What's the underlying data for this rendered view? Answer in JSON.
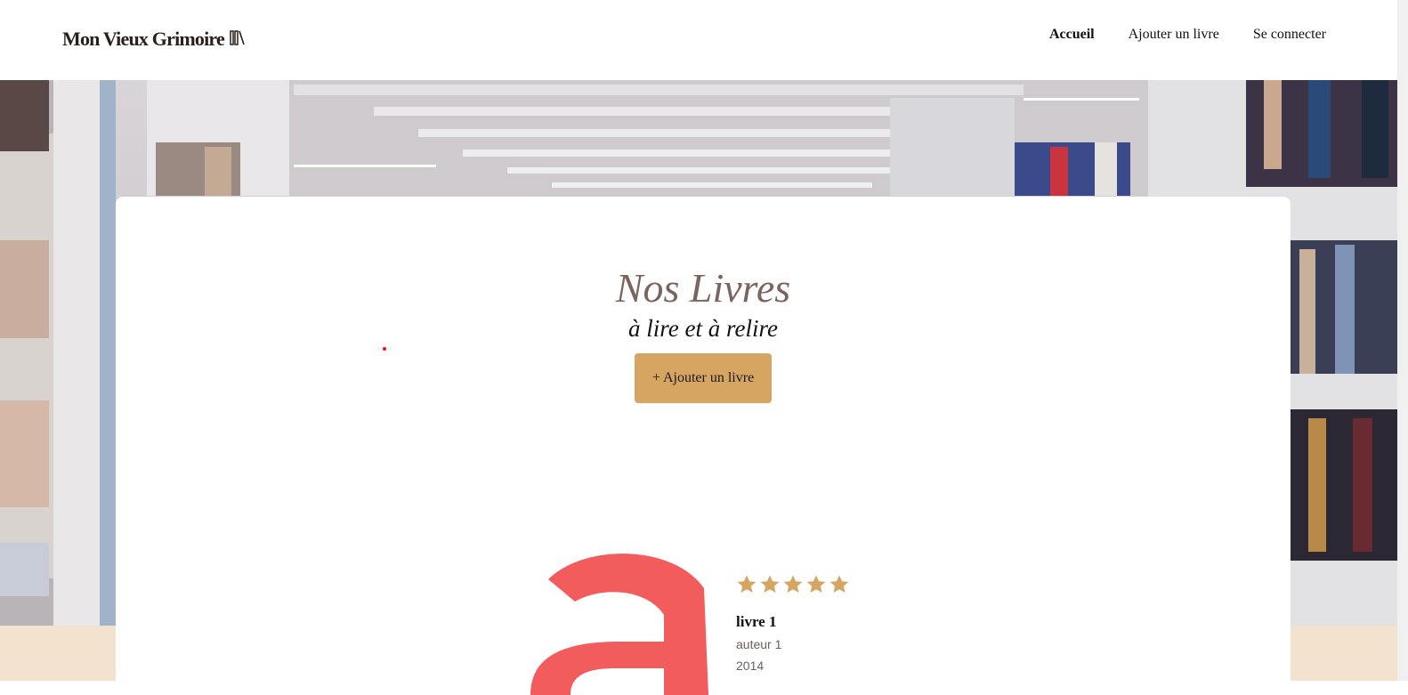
{
  "header": {
    "logo_text": "Mon Vieux Grimoire",
    "nav": [
      {
        "label": "Accueil",
        "active": true
      },
      {
        "label": "Ajouter un livre",
        "active": false
      },
      {
        "label": "Se connecter",
        "active": false
      }
    ]
  },
  "main": {
    "title": "Nos Livres",
    "subtitle": "à lire et à relire",
    "add_button_label": "+ Ajouter un livre",
    "books": [
      {
        "cover_letter": "a",
        "rating": 5,
        "title": "livre 1",
        "author": "auteur 1",
        "year": "2014"
      }
    ]
  },
  "colors": {
    "accent": "#d6a561",
    "title": "#7a6460",
    "cover_letter": "#f25c5c",
    "beige": "#f3e2cd"
  },
  "icons": [
    "logo-books-icon",
    "star-icon"
  ]
}
